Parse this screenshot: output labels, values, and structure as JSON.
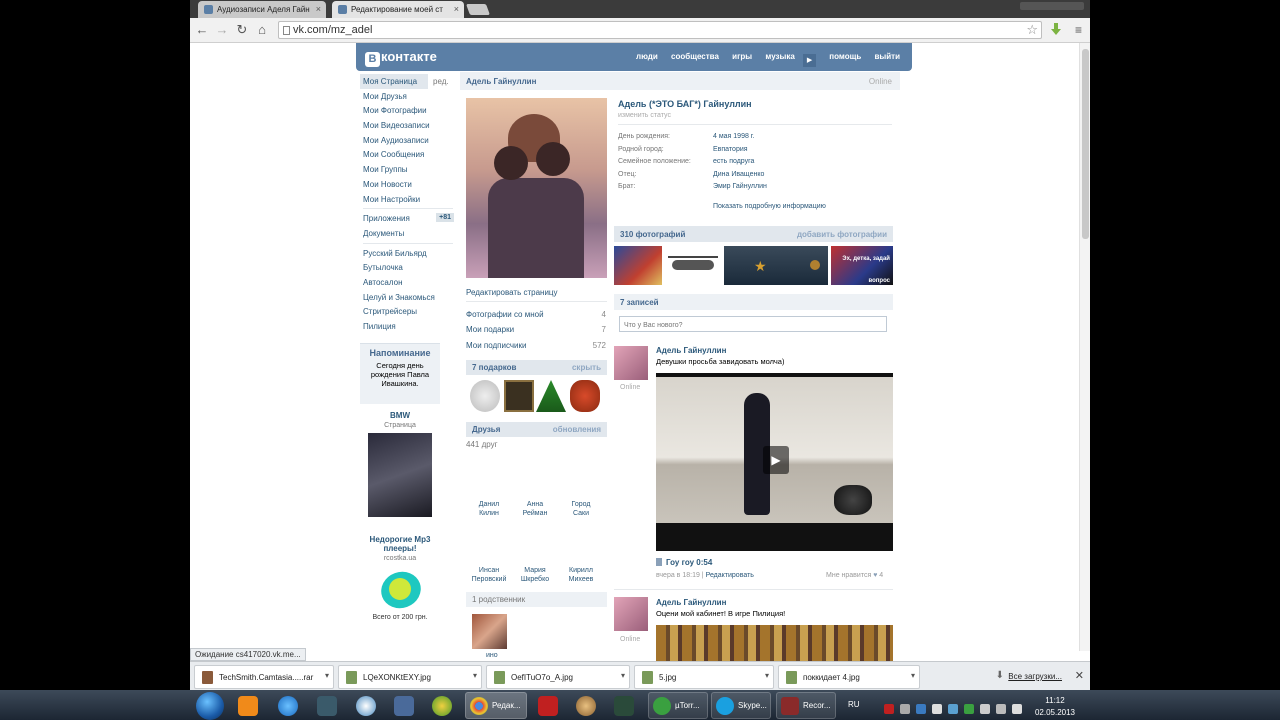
{
  "browser": {
    "tabs": [
      {
        "title": "Аудиозаписи Аделя Гайн"
      },
      {
        "title": "Редактирование моей ст"
      }
    ],
    "url": "vk.com/mz_adel",
    "status": "Ожидание cs417020.vk.me..."
  },
  "vk": {
    "logo": "контакте",
    "logo_letter": "В",
    "nav": [
      "люди",
      "сообщества",
      "игры",
      "музыка",
      "помощь",
      "выйти"
    ],
    "left_menu": {
      "items": [
        "Моя Страница",
        "Мои Друзья",
        "Мои Фотографии",
        "Мои Видеозаписи",
        "Мои Аудиозаписи",
        "Мои Сообщения",
        "Мои Группы",
        "Мои Новости",
        "Мои Настройки"
      ],
      "edit": "ред.",
      "apps": "Приложения",
      "apps_badge": "+81",
      "docs": "Документы",
      "app_list": [
        "Русский Бильярд",
        "Бутылочка",
        "Автосалон",
        "Целуй и Знакомься",
        "Стритрейсеры",
        "Пилиция"
      ]
    },
    "reminder": {
      "title": "Напоминание",
      "text": "Сегодня день рождения Павла Ивашкина."
    },
    "ads": [
      {
        "title": "BMW",
        "sub": "Страница"
      },
      {
        "title": "Недорогие Mp3 плееры!",
        "sub": "rcostka.ua",
        "price": "Всего от 200 грн."
      }
    ],
    "profile": {
      "name_bar": "Адель Гайнуллин",
      "online": "Online",
      "full_name": "Адель (*ЭТО БАГ*) Гайнуллин",
      "status_hint": "изменить статус",
      "info": [
        {
          "label": "День рождения:",
          "value": "4 мая 1998 г."
        },
        {
          "label": "Родной город:",
          "value": "Евпатория"
        },
        {
          "label": "Семейное положение:",
          "value": "есть подруга"
        },
        {
          "label": "Отец:",
          "value": "Дина Иващенко"
        },
        {
          "label": "Брат:",
          "value": "Эмир Гайнуллин"
        }
      ],
      "more_info": "Показать подробную информацию",
      "edit_page": "Редактировать страницу",
      "links": [
        {
          "label": "Фотографии со мной",
          "count": "4"
        },
        {
          "label": "Мои подарки",
          "count": "7"
        },
        {
          "label": "Мои подписчики",
          "count": "572"
        }
      ],
      "gifts": {
        "title": "7 подарков",
        "action": "скрыть"
      },
      "friends": {
        "title": "Друзья",
        "action": "обновления",
        "count": "441 друг",
        "names": [
          [
            "Данил",
            "Килин"
          ],
          [
            "Анна",
            "Рейман"
          ],
          [
            "Город",
            "Саки"
          ],
          [
            "Инсан",
            "Перовский"
          ],
          [
            "Мария",
            "Шкребко"
          ],
          [
            "Кирилл",
            "Михеев"
          ]
        ]
      },
      "relatives": "1 родственник",
      "relative_name": "ино"
    },
    "photos": {
      "title": "310 фотографий",
      "action": "добавить фотографии",
      "thumb_text": "Эх, детка, задай вопрос"
    },
    "wall": {
      "title": "7 записей",
      "placeholder": "Что у Вас нового?",
      "posts": [
        {
          "author": "Адель Гайнуллин",
          "text": "Девушки просьба завидовать молча)",
          "online": "Online",
          "video_title": "Гоу гоу 0:54",
          "meta": "вчера в 18:19",
          "edit": "Редактировать",
          "like": "Мне нравится",
          "likes": "4"
        },
        {
          "author": "Адель Гайнуллин",
          "text": "Оцени мой кабинет! В игре Пилиция!",
          "online": "Online"
        }
      ]
    }
  },
  "downloads": {
    "items": [
      "TechSmith.Camtasia.....rar",
      "LQeXONKtEXY.jpg",
      "OefITuO7o_A.jpg",
      "5.jpg",
      "поккидает 4.jpg"
    ],
    "show_all": "Все загрузки..."
  },
  "taskbar": {
    "buttons": [
      "Редак...",
      "µTorr...",
      "Skype...",
      "Recor..."
    ],
    "lang": "RU",
    "time": "11:12",
    "date": "02.05.2013"
  }
}
